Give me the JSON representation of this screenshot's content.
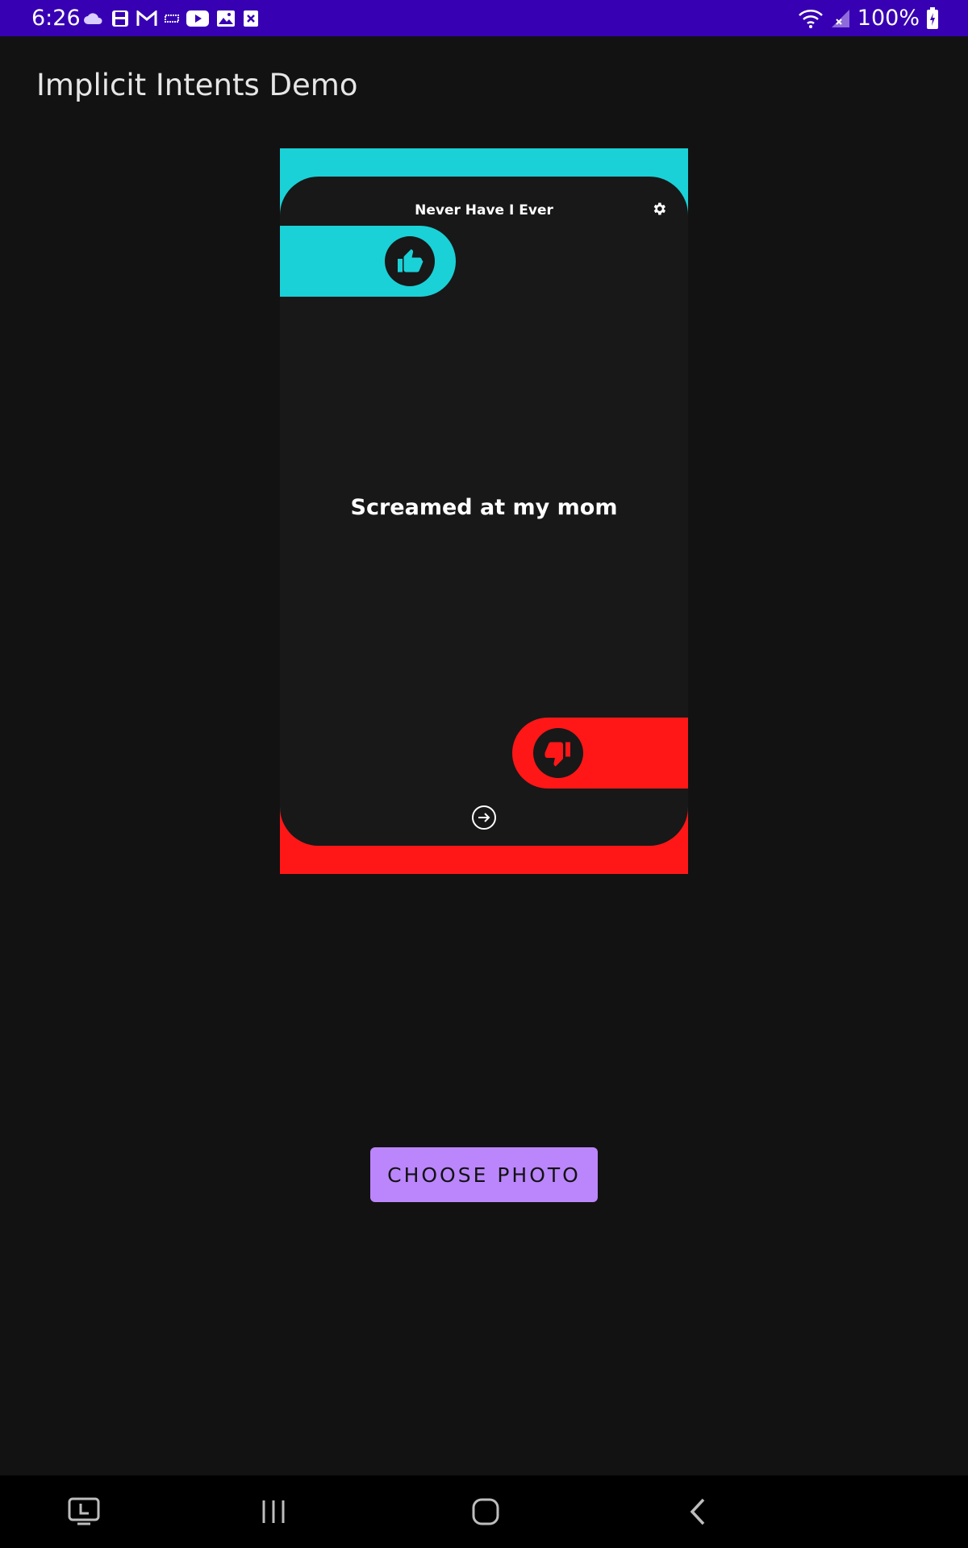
{
  "status_bar": {
    "time": "6:26",
    "battery_percent": "100%",
    "background_color": "#3700b3",
    "left_icons": [
      "cloud-icon",
      "save-icon",
      "gmail-icon",
      "game-icon",
      "youtube-icon",
      "gallery-icon",
      "excel-icon"
    ],
    "right_icons": [
      "wifi-icon",
      "signal-icon",
      "battery-charging-icon"
    ]
  },
  "app": {
    "title": "Implicit Intents Demo",
    "background_color": "#121212"
  },
  "preview_image": {
    "game_title": "Never Have I Ever",
    "statement": "Screamed at my mom",
    "accent_top": "#1ad1d7",
    "accent_bottom": "#ff1717",
    "icons": [
      "settings-gear-icon",
      "thumbs-up-icon",
      "thumbs-down-icon",
      "next-arrow-icon"
    ]
  },
  "actions": {
    "choose_photo_label": "CHOOSE PHOTO",
    "button_color": "#bb86fc"
  },
  "nav_bar": {
    "buttons": [
      "recent-apps-special-icon",
      "recents-icon",
      "home-icon",
      "back-icon"
    ]
  }
}
